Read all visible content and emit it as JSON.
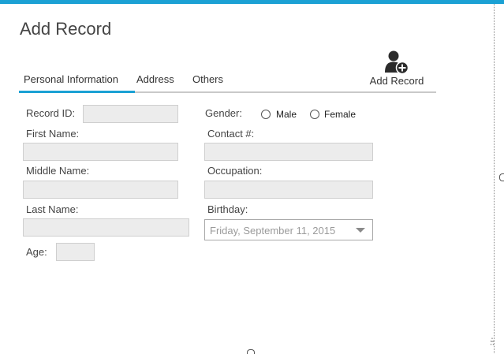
{
  "window": {
    "title": "Add Record"
  },
  "tabs": [
    {
      "label": "Personal Information",
      "active": true
    },
    {
      "label": "Address",
      "active": false
    },
    {
      "label": "Others",
      "active": false
    }
  ],
  "toolbar": {
    "add_record_label": "Add Record",
    "add_record_icon": "add-user-icon"
  },
  "form": {
    "record_id": {
      "label": "Record ID:",
      "value": ""
    },
    "gender": {
      "label": "Gender:",
      "options": [
        "Male",
        "Female"
      ],
      "selected": null
    },
    "first_name": {
      "label": "First Name:",
      "value": ""
    },
    "contact": {
      "label": "Contact #:",
      "value": ""
    },
    "middle_name": {
      "label": "Middle Name:",
      "value": ""
    },
    "occupation": {
      "label": "Occupation:",
      "value": ""
    },
    "last_name": {
      "label": "Last Name:",
      "value": ""
    },
    "birthday": {
      "label": "Birthday:",
      "value": "Friday, September 11, 2015"
    },
    "age": {
      "label": "Age:",
      "value": ""
    }
  },
  "colors": {
    "accent": "#1ba1d4",
    "field_bg": "#ececec",
    "tab_line": "#c9c9c9"
  }
}
